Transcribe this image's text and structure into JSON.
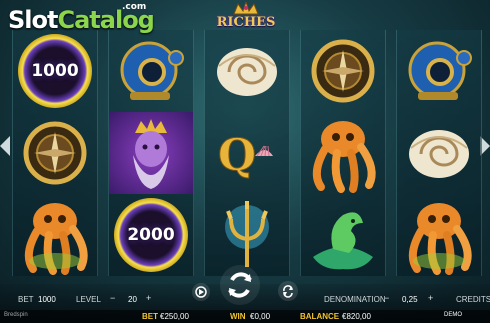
{
  "watermark": {
    "text_a": "Slot",
    "text_b": "Catalog",
    "suffix": ".com"
  },
  "game_logo": {
    "text": "RICHES"
  },
  "reels": [
    [
      "1000",
      "compass",
      "octopus"
    ],
    [
      "diving-helmet",
      "neptune",
      "2000"
    ],
    [
      "shell",
      "Q",
      "trident"
    ],
    [
      "compass",
      "octopus",
      "seahorse"
    ],
    [
      "diving-helmet",
      "shell",
      "octopus"
    ]
  ],
  "bottom_bar": {
    "bet_label": "BET",
    "bet_value": "1000",
    "level_label": "LEVEL",
    "level_value": "20",
    "minus": "−",
    "plus": "+",
    "denomination_label": "DENOMINATION",
    "denomination_value": "0,25",
    "credits_label": "CREDITS",
    "bet_money_label": "BET",
    "bet_money_value": "€250,00",
    "win_label": "WIN",
    "win_value": "€0,00",
    "balance_label": "BALANCE",
    "balance_value": "€820,00",
    "mode": "DEMO",
    "footer": "Bredspin"
  },
  "colors": {
    "accent_gold": "#f1c52c",
    "background_teal": "#1f4d55"
  }
}
